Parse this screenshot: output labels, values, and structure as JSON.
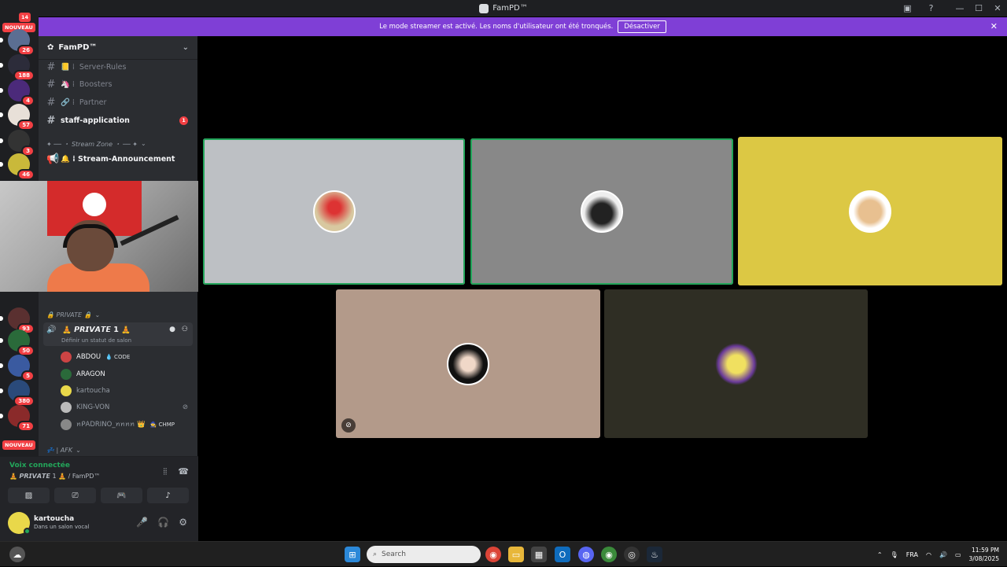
{
  "window": {
    "title": "FamPD™"
  },
  "banner": {
    "message": "Le mode streamer est activé. Les noms d'utilisateur ont été tronqués.",
    "button": "Désactiver"
  },
  "servers": {
    "badges": [
      "14",
      "26",
      "188",
      "4",
      "57",
      "3",
      "46",
      "79",
      "93",
      "50",
      "5",
      "380",
      "71"
    ],
    "new_label_top": "NOUVEAU",
    "new_label_bottom": "NOUVEAU"
  },
  "guild": {
    "name": "FamPD™",
    "channels": [
      {
        "prefix": "📒 ⁞",
        "name": "Server-Rules"
      },
      {
        "prefix": "🦄 ⁞",
        "name": "Boosters"
      },
      {
        "prefix": "🔗 ⁞",
        "name": "Partner"
      },
      {
        "prefix": "",
        "name": "staff-application",
        "unread": "1"
      }
    ],
    "category_stream": "✦ ── ・ Stream Zone ・ ── ✦",
    "announcement_channel": "🔔 ⁞ Stream-Announcement",
    "category_private": "🔒 PRIVATE 🔒",
    "voice_channel": "🧘 𝙋𝙍𝙄𝙑𝘼𝙏𝙀 1 🧘",
    "voice_status": "Définir un statut de salon",
    "members": [
      {
        "name": "ABDOU",
        "tag": "💧 CODE"
      },
      {
        "name": "ARAGON",
        "tag": ""
      },
      {
        "name": "kartoucha",
        "tag": ""
      },
      {
        "name": "KING-VON",
        "tag": ""
      },
      {
        "name": "ꪀᑭADRINO_ꪀꪀꪀꪀ 👑",
        "tag": "🧙 CHMP"
      }
    ],
    "category_afk": "💤 | AFK"
  },
  "voice_panel": {
    "status": "Voix connectée",
    "channel": "🧘 𝙋𝙍𝙄𝙑𝘼𝙏𝙀 1 🧘 / FamPD™"
  },
  "user": {
    "name": "kartoucha",
    "status": "Dans un salon vocal"
  },
  "taskbar": {
    "search_placeholder": "Search",
    "language": "FRA",
    "time": "11:59 PM",
    "date": "3/08/2025"
  },
  "colors": {
    "banner": "#7f3fd6",
    "speaking": "#23a55a",
    "tile1": "#bdc0c4",
    "tile2": "#888888",
    "tile3": "#dcc844",
    "tile4": "#b39a8a",
    "tile5": "#2f2e24"
  }
}
